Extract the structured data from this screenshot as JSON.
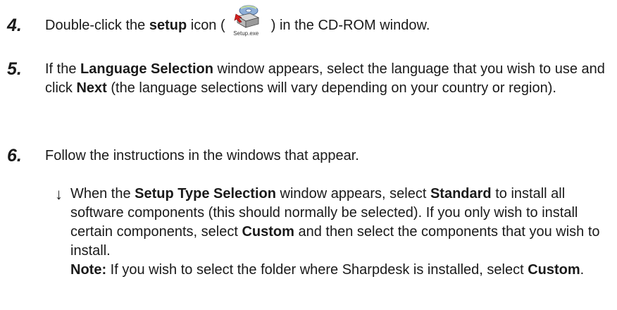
{
  "steps": [
    {
      "number": "4.",
      "text_a": "Double-click the ",
      "bold_a": "setup",
      "text_b": " icon ( ",
      "icon_name": "setup-exe-icon",
      "icon_caption": "Setup.exe",
      "text_c": " ) in the CD-ROM window."
    },
    {
      "number": "5.",
      "text_a": "If the ",
      "bold_a": "Language Selection",
      "text_b": " window appears, select the language that you wish to use and click ",
      "bold_b": "Next",
      "text_c": " (the language selections will vary depending on your country or region)."
    },
    {
      "number": "6.",
      "text_a": "Follow the instructions in the windows that appear."
    }
  ],
  "substep": {
    "bullet": "↓",
    "text_a": "When the ",
    "bold_a": "Setup Type Selection",
    "text_b": " window appears, select ",
    "bold_b": "Standard",
    "text_c": " to install all software components (this should normally be selected). If you only wish to install certain components, select ",
    "bold_c": "Custom",
    "text_d": " and then select the components that you wish to install.",
    "note_label": "Note:",
    "note_text": " If you wish to select the folder where Sharpdesk is installed, select ",
    "note_bold": "Custom",
    "note_end": "."
  }
}
